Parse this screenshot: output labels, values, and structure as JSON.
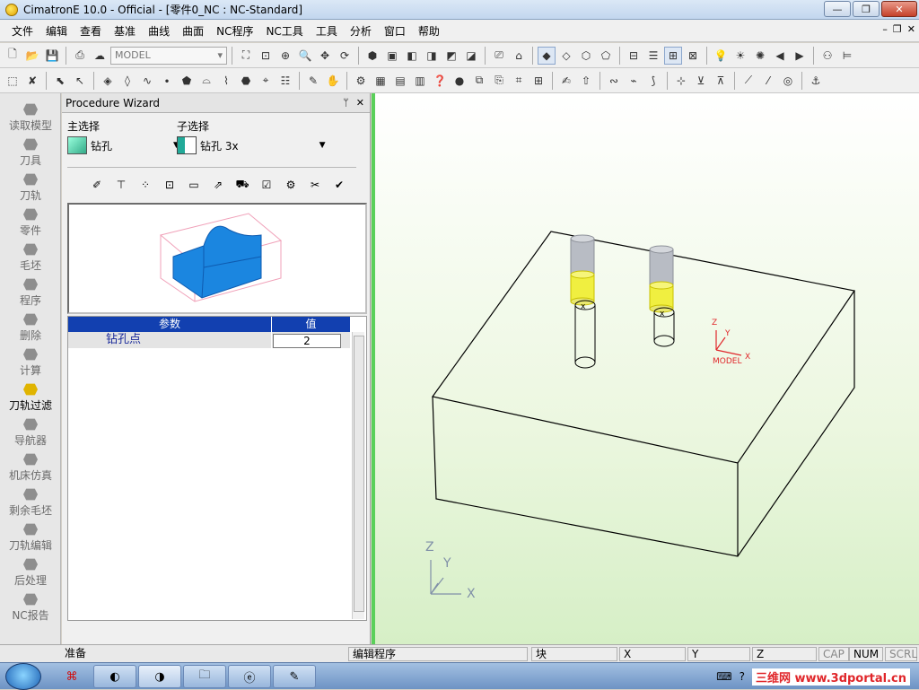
{
  "window": {
    "title": "CimatronE 10.0 - Official - [零件0_NC : NC-Standard]",
    "min": "—",
    "max": "❐",
    "close": "✕"
  },
  "menu": [
    "文件",
    "编辑",
    "查看",
    "基准",
    "曲线",
    "曲面",
    "NC程序",
    "NC工具",
    "工具",
    "分析",
    "窗口",
    "帮助"
  ],
  "mdi_controls": {
    "min": "–",
    "restore": "❐",
    "close": "✕"
  },
  "toolbar": {
    "model_combo": "MODEL"
  },
  "left_bar": [
    {
      "label": "读取模型"
    },
    {
      "label": "刀具"
    },
    {
      "label": "刀轨"
    },
    {
      "label": "零件"
    },
    {
      "label": "毛坯"
    },
    {
      "label": "程序"
    },
    {
      "label": "删除"
    },
    {
      "label": "计算"
    },
    {
      "label": "刀轨过滤"
    },
    {
      "label": "导航器"
    },
    {
      "label": "机床仿真"
    },
    {
      "label": "剩余毛坯"
    },
    {
      "label": "刀轨编辑"
    },
    {
      "label": "后处理"
    },
    {
      "label": "NC报告"
    }
  ],
  "wizard": {
    "title": "Procedure Wizard",
    "pin": "ᛘ",
    "close": "✕",
    "main_label": "主选择",
    "sub_label": "子选择",
    "main_value": "钻孔",
    "sub_value": "钻孔 3x",
    "param_header": "参数",
    "value_header": "值",
    "params": [
      {
        "name": "钻孔点",
        "value": "2"
      }
    ]
  },
  "viewport": {
    "model_label": "MODEL",
    "axis_z": "Z",
    "axis_y": "Y",
    "axis_x": "X",
    "tri_z": "Z",
    "tri_y": "Y",
    "tri_x": "X",
    "drill_marker": "x"
  },
  "status": {
    "left": "准备",
    "program": "编辑程序",
    "block": "块",
    "x": "X",
    "y": "Y",
    "z": "Z",
    "cap": "CAP",
    "num": "NUM",
    "scrl": "SCRL"
  },
  "tray": {
    "watermark": "三维网 www.3dportal.cn"
  },
  "colors": {
    "accent": "#1240b0",
    "viewport_border": "#5ad05a",
    "tool_yellow": "#f0ef40",
    "part_blue": "#1b86e0"
  }
}
